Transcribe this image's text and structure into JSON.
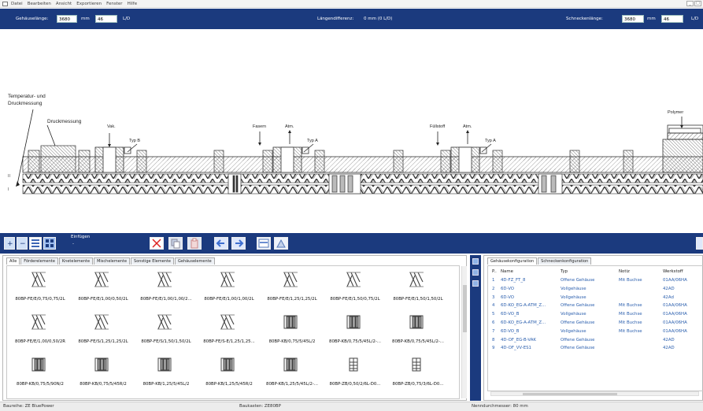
{
  "menubar": {
    "items": [
      "Datei",
      "Bearbeiten",
      "Ansicht",
      "Exportieren",
      "Fenster",
      "Hilfe"
    ]
  },
  "header": {
    "gehause_label": "Gehäuselänge:",
    "gehause_mm": "3680",
    "unit_mm": "mm",
    "gehause_ld": "46",
    "unit_ld": "L/D",
    "diff_label": "Längendifferenz:",
    "diff_value": "0 mm (0 L/D)",
    "schnecke_label": "Schneckenlänge:",
    "schnecke_mm": "3680",
    "schnecke_ld": "46"
  },
  "drawing": {
    "annotations": {
      "temp1": "Temperatur- und",
      "temp2": "Druckmessung",
      "druck": "Druckmessung",
      "vak": "Vak.",
      "typb": "Typ B",
      "fasern": "Fasern",
      "atm1": "Atm.",
      "typa1": "Typ A",
      "fuellstoff": "Füllstoff",
      "atm2": "Atm.",
      "typa2": "Typ A",
      "polymer": "Polymer"
    },
    "axis_marks": {
      "upper": "II",
      "lower": "I"
    }
  },
  "toolbar": {
    "insert_label": "Einfügen",
    "insert_value": "-"
  },
  "left_panel": {
    "tabs": [
      "Alle",
      "Förderelemente",
      "Knetelemente",
      "Mischelemente",
      "Sonstige Elemente",
      "Gehäuselemente"
    ],
    "items": [
      {
        "label": "80BP-FE/E/0,75/0,75/2L",
        "icon": "conveying-element-icon"
      },
      {
        "label": "80BP-FE/E/1,00/0,50/2L",
        "icon": "conveying-element-icon"
      },
      {
        "label": "80BP-FE/E/1,00/1,00/2...",
        "icon": "conveying-element-icon"
      },
      {
        "label": "80BP-FE/E/1,00/1,00/2L",
        "icon": "conveying-element-icon"
      },
      {
        "label": "80BP-FE/E/1,25/1,25/2L",
        "icon": "conveying-element-icon"
      },
      {
        "label": "80BP-FE/E/1,50/0,75/2L",
        "icon": "conveying-element-icon"
      },
      {
        "label": "80BP-FE/E/1,50/1,50/2L",
        "icon": "conveying-element-icon"
      },
      {
        "label": "80BP-FE/E/1,00/0,50/2R",
        "icon": "conveying-element-icon"
      },
      {
        "label": "80BP-FE/S/1,25/1,25/2L",
        "icon": "conveying-element-icon"
      },
      {
        "label": "80BP-FE/S/1,50/1,50/2L",
        "icon": "conveying-element-icon"
      },
      {
        "label": "80BP-FE/S-E/1,25/1,25...",
        "icon": "conveying-element-icon"
      },
      {
        "label": "80BP-KB/0,75/5/45L/2",
        "icon": "kneading-block-icon"
      },
      {
        "label": "80BP-KB/0,75/5/45L/2-...",
        "icon": "kneading-block-icon"
      },
      {
        "label": "80BP-KB/0,75/5/45L/2-...",
        "icon": "kneading-block-icon"
      },
      {
        "label": "80BP-KB/0,75/5/90N/2",
        "icon": "kneading-block-icon"
      },
      {
        "label": "80BP-KB/0,75/5/45R/2",
        "icon": "kneading-block-icon"
      },
      {
        "label": "80BP-KB/1,25/5/45L/2",
        "icon": "kneading-block-icon"
      },
      {
        "label": "80BP-KB/1,25/5/45R/2",
        "icon": "kneading-block-icon"
      },
      {
        "label": "80BP-KB/1,25/5/45L/2-...",
        "icon": "kneading-block-icon"
      },
      {
        "label": "80BP-ZB/0,50/2/6L-D0...",
        "icon": "mixing-element-icon"
      },
      {
        "label": "80BP-ZB/0,75/3/6L-D0...",
        "icon": "mixing-element-icon"
      }
    ]
  },
  "right_panel": {
    "tabs": [
      "Gehäusekonfiguration",
      "Schneckenkonfiguration"
    ],
    "columns": [
      "P..",
      "Name",
      "Typ",
      "Notiz",
      "Werkstoff"
    ],
    "rows": [
      {
        "p": "1",
        "name": "4D-FZ_FT_8",
        "typ": "Offene Gehäuse",
        "notiz": "Mit Buchse",
        "werkstoff": "01AA/06HA"
      },
      {
        "p": "2",
        "name": "6D-VO",
        "typ": "Vollgehäuse",
        "notiz": "",
        "werkstoff": "42AD"
      },
      {
        "p": "3",
        "name": "6D-VO",
        "typ": "Vollgehäuse",
        "notiz": "",
        "werkstoff": "42Ad"
      },
      {
        "p": "4",
        "name": "6D-KO_EG-A-ATM_Z...",
        "typ": "Offene Gehäuse",
        "notiz": "Mit Buchse",
        "werkstoff": "01AA/06HA"
      },
      {
        "p": "5",
        "name": "6D-VO_B",
        "typ": "Vollgehäuse",
        "notiz": "Mit Buchse",
        "werkstoff": "01AA/06HA"
      },
      {
        "p": "6",
        "name": "6D-KO_EG-A-ATM_Z...",
        "typ": "Offene Gehäuse",
        "notiz": "Mit Buchse",
        "werkstoff": "01AA/06HA"
      },
      {
        "p": "7",
        "name": "6D-VO_B",
        "typ": "Vollgehäuse",
        "notiz": "Mit Buchse",
        "werkstoff": "01AA/06HA"
      },
      {
        "p": "8",
        "name": "4D-OF_EG-B-VAK",
        "typ": "Offene Gehäuse",
        "notiz": "",
        "werkstoff": "42AD"
      },
      {
        "p": "9",
        "name": "4D-OF_VV-ES1",
        "typ": "Offene Gehäuse",
        "notiz": "",
        "werkstoff": "42AD"
      }
    ]
  },
  "status": {
    "baureihe": "Baureihe: ZE BluePower",
    "baukasten": "Baukasten: ZE80BP",
    "nenn": "Nenndurchmesser: 80 mm"
  }
}
